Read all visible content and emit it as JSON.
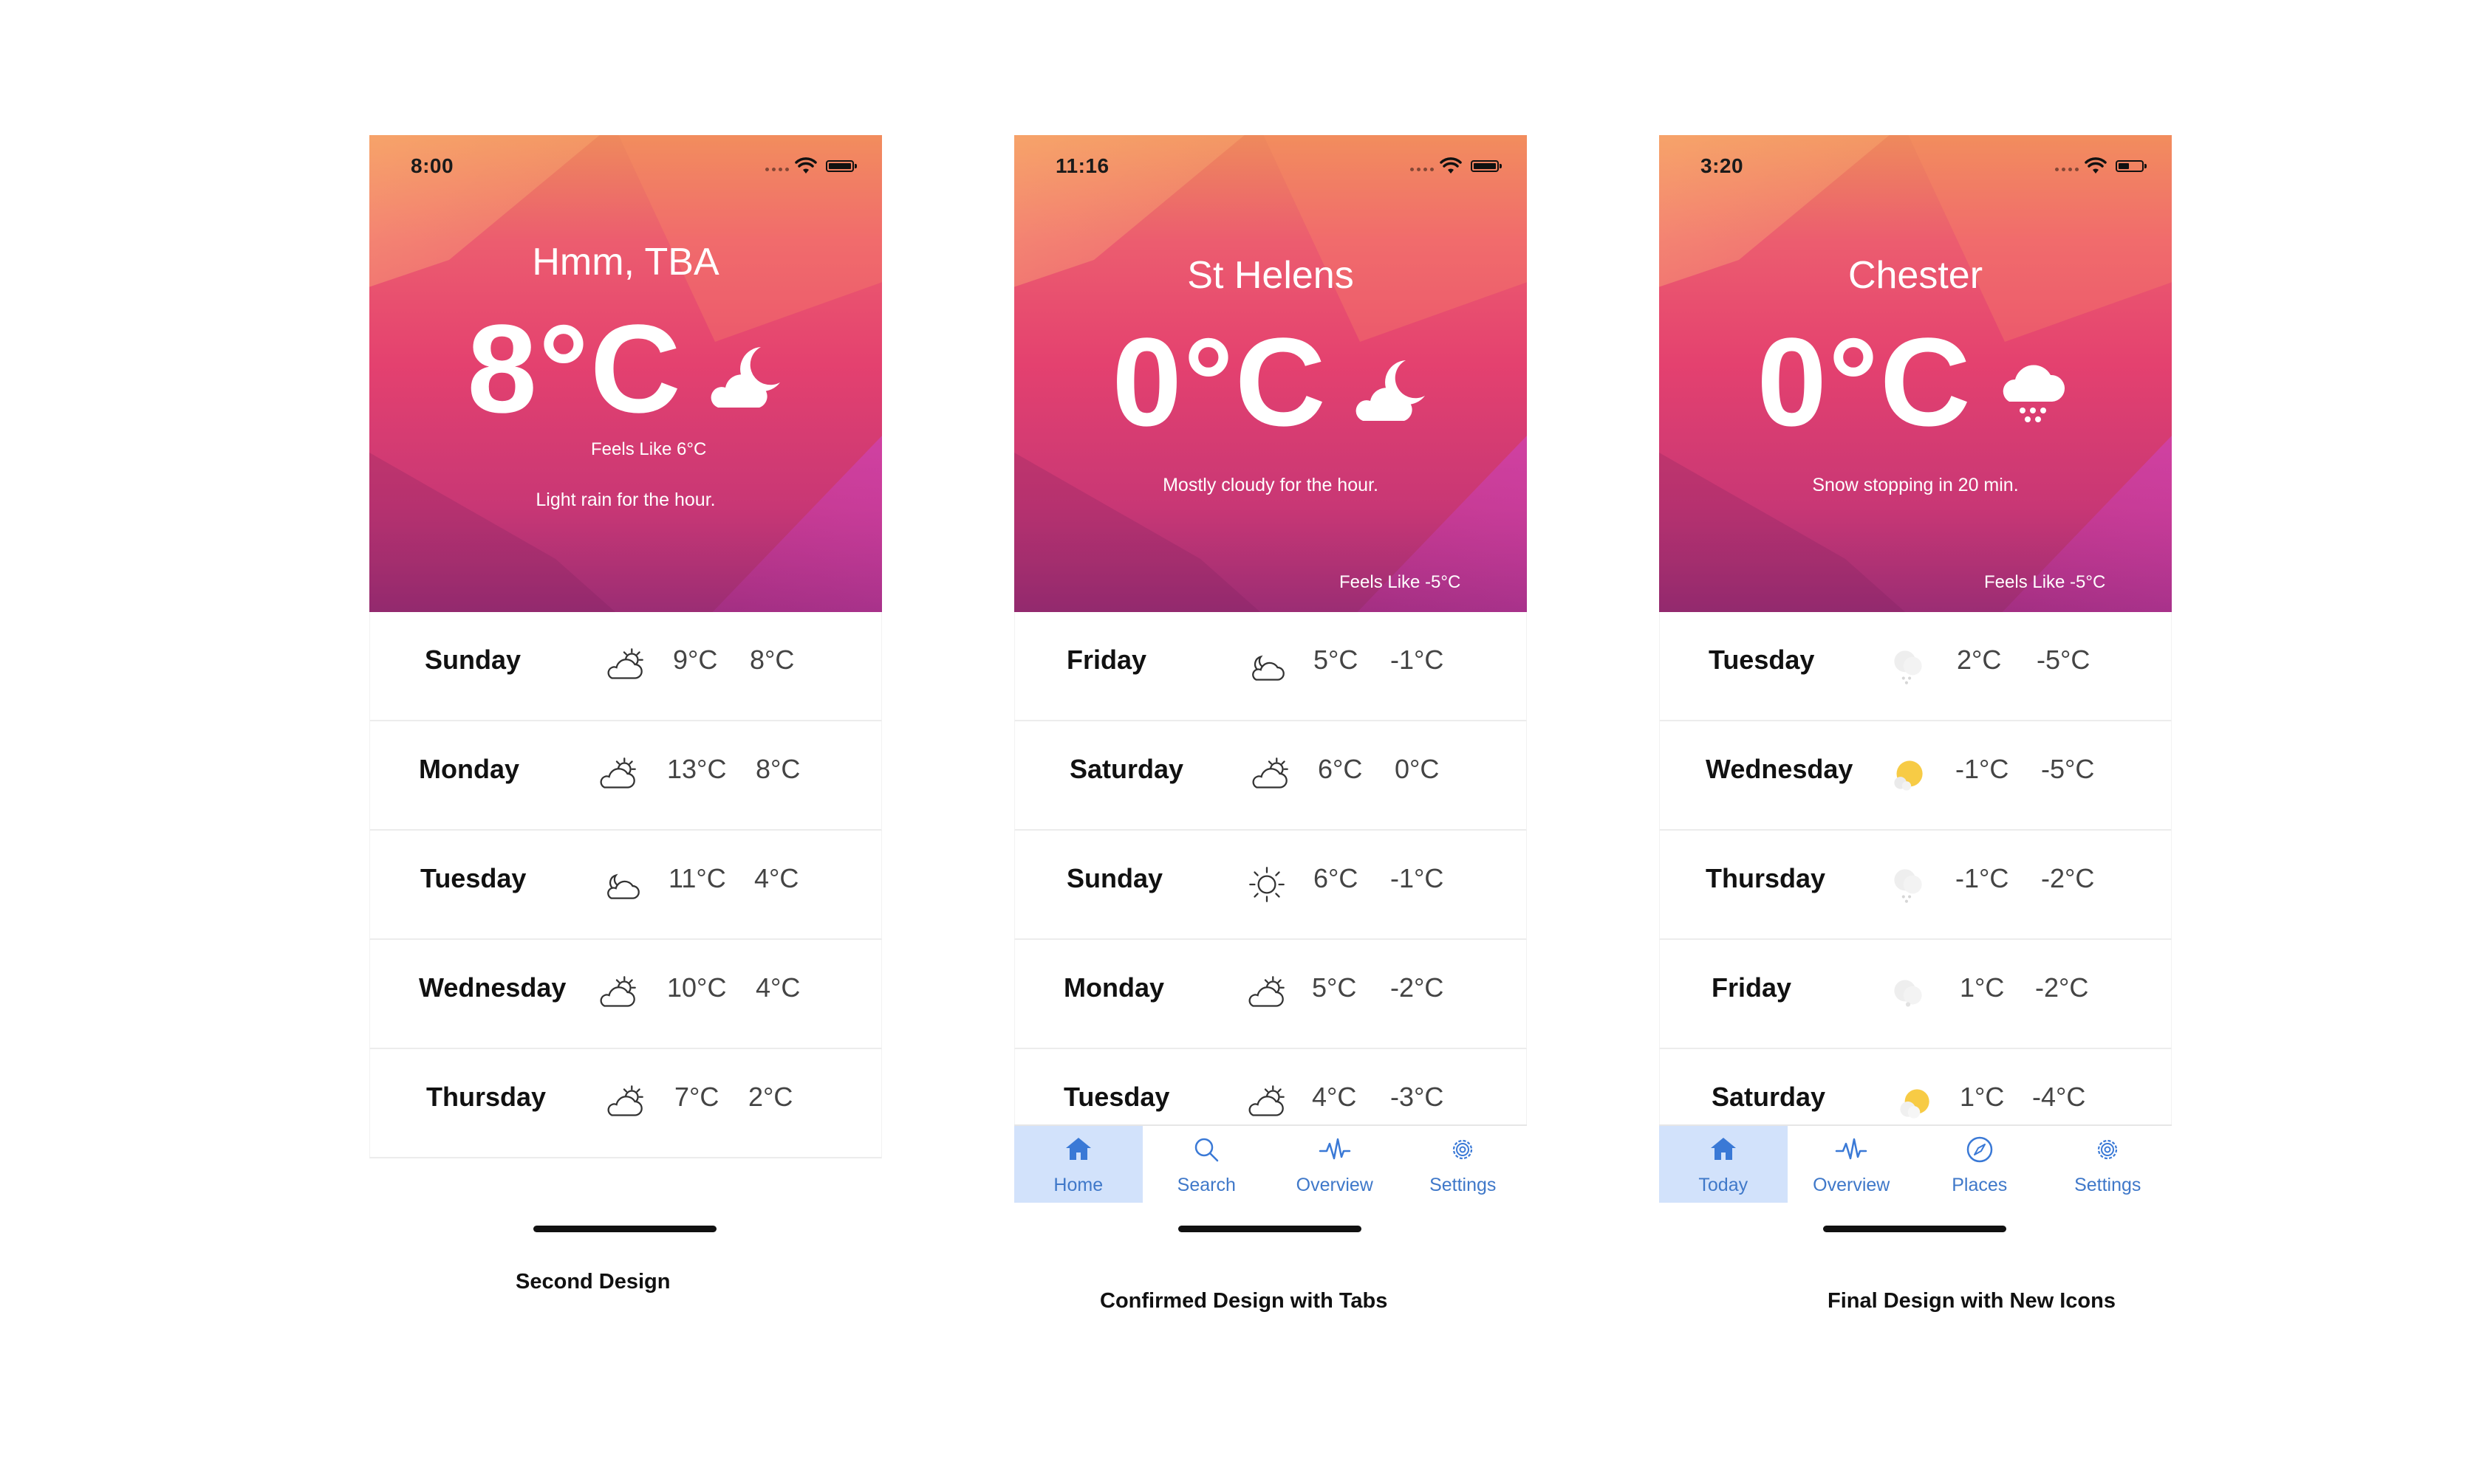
{
  "designs": [
    {
      "status_time": "8:00",
      "city": "Hmm, TBA",
      "temperature": "8°C",
      "feels_like": "Feels Like 6°C",
      "summary": "Light rain for the hour.",
      "hero_icon": "moon-cloud-icon",
      "days": [
        {
          "day": "Sunday",
          "icon": "partly-sunny-outline-icon",
          "high": "9°C",
          "low": "8°C"
        },
        {
          "day": "Monday",
          "icon": "partly-sunny-outline-icon",
          "high": "13°C",
          "low": "8°C"
        },
        {
          "day": "Tuesday",
          "icon": "moon-cloud-outline-icon",
          "high": "11°C",
          "low": "4°C"
        },
        {
          "day": "Wednesday",
          "icon": "partly-sunny-outline-icon",
          "high": "10°C",
          "low": "4°C"
        },
        {
          "day": "Thursday",
          "icon": "partly-sunny-outline-icon",
          "high": "7°C",
          "low": "2°C"
        }
      ],
      "caption": "Second Design"
    },
    {
      "status_time": "11:16",
      "city": "St Helens",
      "temperature": "0°C",
      "feels_like": "Feels Like -5°C",
      "summary": "Mostly cloudy for the hour.",
      "hero_icon": "moon-cloud-icon",
      "days": [
        {
          "day": "Friday",
          "icon": "moon-cloud-outline-icon",
          "high": "5°C",
          "low": "-1°C"
        },
        {
          "day": "Saturday",
          "icon": "partly-sunny-outline-icon",
          "high": "6°C",
          "low": "0°C"
        },
        {
          "day": "Sunday",
          "icon": "sun-outline-icon",
          "high": "6°C",
          "low": "-1°C"
        },
        {
          "day": "Monday",
          "icon": "partly-sunny-outline-icon",
          "high": "5°C",
          "low": "-2°C"
        },
        {
          "day": "Tuesday",
          "icon": "partly-sunny-outline-icon",
          "high": "4°C",
          "low": "-3°C"
        }
      ],
      "tabs": [
        {
          "label": "Home",
          "icon": "home-icon",
          "active": true
        },
        {
          "label": "Search",
          "icon": "search-icon",
          "active": false
        },
        {
          "label": "Overview",
          "icon": "pulse-icon",
          "active": false
        },
        {
          "label": "Settings",
          "icon": "gear-icon",
          "active": false
        }
      ],
      "caption": "Confirmed Design with Tabs"
    },
    {
      "status_time": "3:20",
      "city": "Chester",
      "temperature": "0°C",
      "feels_like": "Feels Like -5°C",
      "summary": "Snow stopping in 20 min.",
      "hero_icon": "snow-cloud-icon",
      "days": [
        {
          "day": "Tuesday",
          "icon": "snow-cloud-color-icon",
          "high": "2°C",
          "low": "-5°C"
        },
        {
          "day": "Wednesday",
          "icon": "sun-cloud-color-icon",
          "high": "-1°C",
          "low": "-5°C"
        },
        {
          "day": "Thursday",
          "icon": "snow-cloud-color-icon",
          "high": "-1°C",
          "low": "-2°C"
        },
        {
          "day": "Friday",
          "icon": "cloud-color-icon",
          "high": "1°C",
          "low": "-2°C"
        },
        {
          "day": "Saturday",
          "icon": "sun-cloud-color-icon",
          "high": "1°C",
          "low": "-4°C"
        }
      ],
      "tabs": [
        {
          "label": "Today",
          "icon": "home-icon",
          "active": true
        },
        {
          "label": "Overview",
          "icon": "pulse-icon",
          "active": false
        },
        {
          "label": "Places",
          "icon": "compass-icon",
          "active": false
        },
        {
          "label": "Settings",
          "icon": "gear-icon",
          "active": false
        }
      ],
      "caption": "Final Design with New Icons"
    }
  ],
  "colors": {
    "tab_accent": "#3a79d6",
    "tab_active_bg": "#d2e2fb",
    "sun_yellow": "#f7cb45"
  }
}
